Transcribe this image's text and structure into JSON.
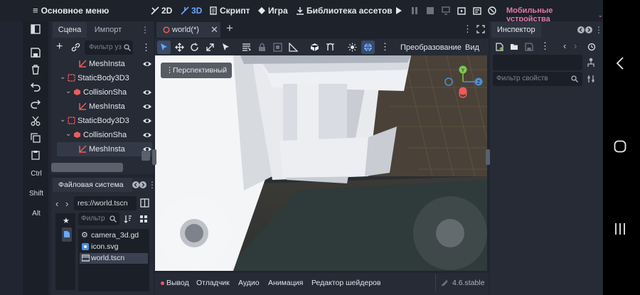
{
  "topbar": {
    "menu_label": "Основное меню",
    "btn_2d": "2D",
    "btn_3d": "3D",
    "btn_script": "Скрипт",
    "btn_game": "Игра",
    "btn_assets": "Библиотека ассетов",
    "renderer": "Мобильные устройства"
  },
  "left_strip": {
    "ctrl": "Ctrl",
    "shift": "Shift",
    "alt": "Alt"
  },
  "scene_panel": {
    "tabs": [
      "Сцена",
      "Импорт"
    ],
    "filter_placeholder": "Фильтр уз",
    "nodes": [
      {
        "label": "MeshInsta",
        "icon": "mesh-instance-icon"
      },
      {
        "label": "StaticBody3D3",
        "icon": "static-body-icon"
      },
      {
        "label": "CollisionSha",
        "icon": "collision-shape-icon"
      },
      {
        "label": "MeshInsta",
        "icon": "mesh-instance-icon"
      },
      {
        "label": "StaticBody3D3",
        "icon": "static-body-icon"
      },
      {
        "label": "CollisionSha",
        "icon": "collision-shape-icon"
      },
      {
        "label": "MeshInsta",
        "icon": "mesh-instance-icon"
      }
    ]
  },
  "fs_panel": {
    "title": "Файловая система",
    "path": "res://world.tscn",
    "filter_placeholder": "Фильтр",
    "files": [
      {
        "name": "camera_3d.gd",
        "icon": "gear-icon"
      },
      {
        "name": "icon.svg",
        "icon": "image-icon"
      },
      {
        "name": "world.tscn",
        "icon": "scene-icon"
      }
    ]
  },
  "editor": {
    "tab_label": "world(*)",
    "transform_label": "Преобразование",
    "view_label": "Вид",
    "perspective_label": "Перспективный"
  },
  "inspector": {
    "tab_label": "Инспектор",
    "filter_placeholder": "Фильтр свойств"
  },
  "bottom_dock": {
    "tabs": [
      "Вывод",
      "Отладчик",
      "Аудио",
      "Анимация",
      "Редактор шейдеров"
    ],
    "version": "4.6.stable"
  },
  "colors": {
    "accent": "#5aa0f0",
    "renderer": "#e07aa8",
    "node_icon": "#ef5b5b"
  }
}
